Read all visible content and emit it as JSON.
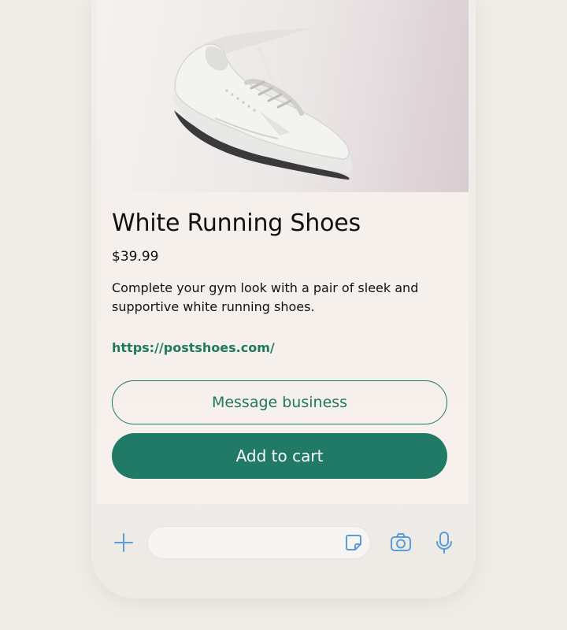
{
  "product": {
    "title": "White Running Shoes",
    "price": "$39.99",
    "description": "Complete your gym look with a pair of sleek and supportive white running shoes.",
    "url": "https://postshoes.com/"
  },
  "actions": {
    "message_label": "Message business",
    "add_to_cart_label": "Add to cart"
  },
  "composer": {
    "icons": [
      "plus-icon",
      "sticker-icon",
      "camera-icon",
      "microphone-icon"
    ],
    "icon_color": "#5b9bd8"
  },
  "colors": {
    "accent": "#207a66",
    "link": "#1f7a5c",
    "page_background": "#efebe5"
  }
}
